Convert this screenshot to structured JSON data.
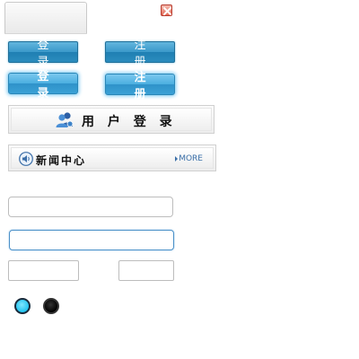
{
  "buttons": {
    "login_label": "登 录",
    "register_label": "注 册"
  },
  "user_login_bar": {
    "label": "用 户 登 录",
    "icon": "users-icon"
  },
  "news_bar": {
    "label": "新闻中心",
    "more_label": "MORE",
    "icon": "speaker-icon"
  },
  "inputs": {
    "wide_1": {
      "value": "",
      "placeholder": ""
    },
    "wide_2": {
      "value": "",
      "placeholder": ""
    },
    "small_1": {
      "value": "",
      "placeholder": ""
    },
    "small_2": {
      "value": "",
      "placeholder": ""
    }
  },
  "radios": [
    {
      "checked": true
    },
    {
      "checked": false
    }
  ],
  "colors": {
    "button_blue": "#2b8cbd",
    "button_hover_blue": "#3aa1d6",
    "focus_border": "#4a90c8",
    "radio_on": "#22c3ef",
    "close_red": "#e46b58",
    "more_link": "#3a6fa8"
  }
}
